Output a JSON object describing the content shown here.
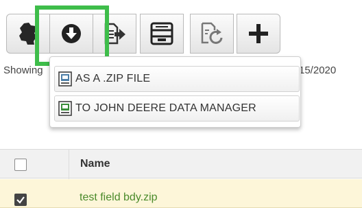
{
  "toolbar": {
    "buttons": [
      {
        "name": "map-boundary-button",
        "icon": "map-boundary-icon"
      },
      {
        "name": "download-button",
        "icon": "download-icon"
      },
      {
        "name": "export-button",
        "icon": "export-icon"
      },
      {
        "name": "archive-button",
        "icon": "archive-icon"
      },
      {
        "name": "refresh-button",
        "icon": "refresh-document-icon"
      },
      {
        "name": "add-button",
        "icon": "plus-icon"
      }
    ],
    "highlight_color": "#3ebd4a"
  },
  "status": {
    "showing_text": "Showing",
    "date_text": "15/2020"
  },
  "download_menu": {
    "items": [
      {
        "label": "AS A .ZIP FILE",
        "icon": "zip-file-icon"
      },
      {
        "label": "TO JOHN DEERE DATA MANAGER",
        "icon": "data-manager-icon"
      }
    ]
  },
  "table": {
    "columns": [
      "Name"
    ],
    "rows": [
      {
        "name": "test field bdy.zip",
        "checked": true
      }
    ],
    "header_checked": false,
    "selected_row_color": "#fdf6d9",
    "link_color": "#4a8a2a"
  }
}
